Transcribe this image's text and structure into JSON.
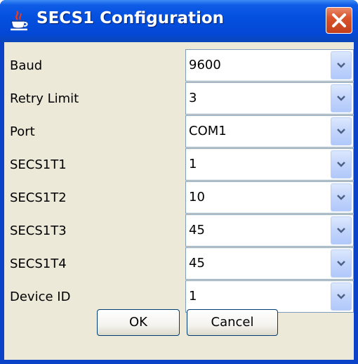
{
  "window": {
    "title": "SECS1 Configuration",
    "icon": "java-icon",
    "close_icon": "close-icon"
  },
  "fields": [
    {
      "label": "Baud",
      "value": "9600"
    },
    {
      "label": "Retry Limit",
      "value": "3"
    },
    {
      "label": "Port",
      "value": "COM1"
    },
    {
      "label": "SECS1T1",
      "value": "1"
    },
    {
      "label": "SECS1T2",
      "value": "10"
    },
    {
      "label": "SECS1T3",
      "value": "45"
    },
    {
      "label": "SECS1T4",
      "value": "45"
    },
    {
      "label": "Device ID",
      "value": "1"
    }
  ],
  "buttons": {
    "ok_label": "OK",
    "cancel_label": "Cancel"
  },
  "colors": {
    "titlebar": "#0450df",
    "dialog_background": "#ece9d8",
    "close_button": "#d9542c",
    "combo_border": "#7f9db9"
  }
}
